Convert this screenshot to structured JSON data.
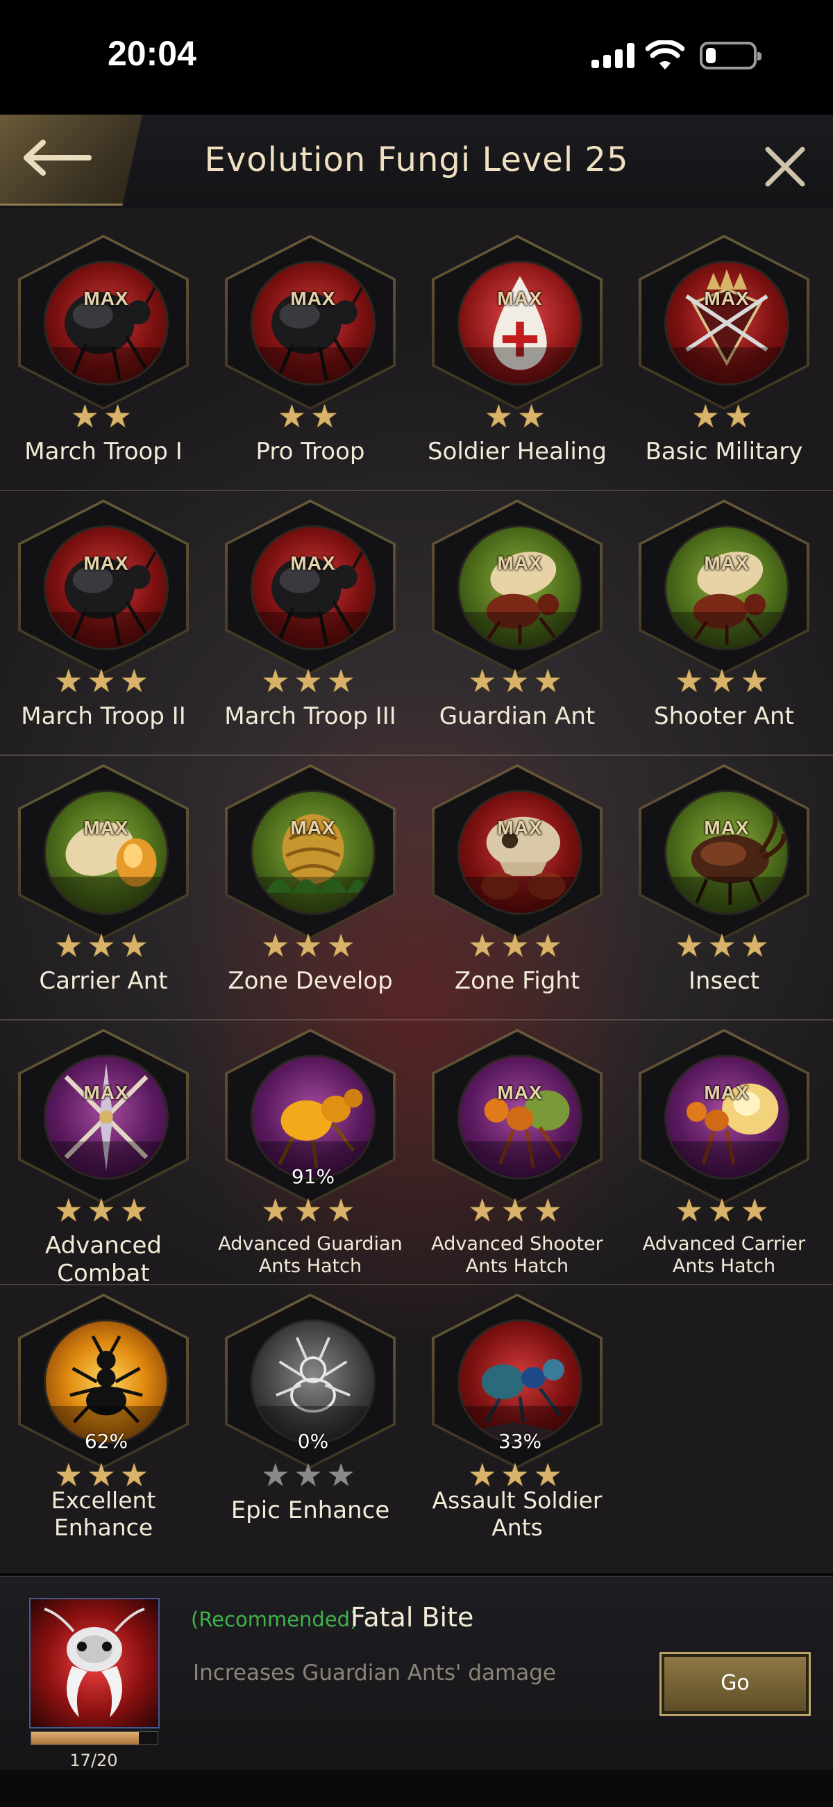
{
  "status_bar": {
    "time": "20:04"
  },
  "header": {
    "title": "Evolution Fungi Level 25"
  },
  "grid": [
    {
      "label": "March Troop I",
      "badge": "MAX",
      "stars": 2,
      "theme": "red",
      "art": "ant-abdomen"
    },
    {
      "label": "Pro Troop",
      "badge": "MAX",
      "stars": 2,
      "theme": "red",
      "art": "ant-abdomen"
    },
    {
      "label": "Soldier Healing",
      "badge": "MAX",
      "stars": 2,
      "theme": "redwhite",
      "art": "blood-drop"
    },
    {
      "label": "Basic Military",
      "badge": "MAX",
      "stars": 2,
      "theme": "red",
      "art": "crossed-swords-crest"
    },
    {
      "label": "March Troop II",
      "badge": "MAX",
      "stars": 3,
      "theme": "red",
      "art": "ant-abdomen"
    },
    {
      "label": "March Troop III",
      "badge": "MAX",
      "stars": 3,
      "theme": "red",
      "art": "ant-abdomen"
    },
    {
      "label": "Guardian Ant",
      "badge": "MAX",
      "stars": 3,
      "theme": "green",
      "art": "ant-with-egg"
    },
    {
      "label": "Shooter Ant",
      "badge": "MAX",
      "stars": 3,
      "theme": "green",
      "art": "ant-with-egg"
    },
    {
      "label": "Carrier Ant",
      "badge": "MAX",
      "stars": 3,
      "theme": "green",
      "art": "egg-amber"
    },
    {
      "label": "Zone Develop",
      "badge": "MAX",
      "stars": 3,
      "theme": "green",
      "art": "fungus-nest"
    },
    {
      "label": "Zone Fight",
      "badge": "MAX",
      "stars": 3,
      "theme": "red",
      "art": "skull"
    },
    {
      "label": "Insect",
      "badge": "MAX",
      "stars": 3,
      "theme": "green",
      "art": "beetle"
    },
    {
      "label": "Advanced Combat",
      "badge": "MAX",
      "stars": 3,
      "theme": "purple",
      "art": "crossed-swords"
    },
    {
      "label": "Advanced Guardian Ants Hatch",
      "badge": "91%",
      "stars": 3,
      "theme": "purple",
      "art": "golden-ant"
    },
    {
      "label": "Advanced Shooter Ants Hatch",
      "badge": "MAX",
      "stars": 3,
      "theme": "purple",
      "art": "ant-orange"
    },
    {
      "label": "Advanced Carrier Ants Hatch",
      "badge": "MAX",
      "stars": 3,
      "theme": "purple",
      "art": "ant-amber"
    },
    {
      "label": "Excellent Enhance",
      "badge": "62%",
      "stars": 3,
      "theme": "orange",
      "art": "ant-silhouette"
    },
    {
      "label": "Epic Enhance",
      "badge": "0%",
      "stars": 3,
      "theme": "gray",
      "art": "ant-ghost"
    },
    {
      "label": "Assault Soldier Ants",
      "badge": "33%",
      "stars": 3,
      "theme": "red",
      "art": "ant-blue"
    }
  ],
  "recommendation": {
    "tag": "(Recommended)",
    "name": "Fatal Bite",
    "description": "Increases Guardian Ants' damage",
    "progress_text": "17/20",
    "progress": 0.85,
    "button": "Go"
  }
}
